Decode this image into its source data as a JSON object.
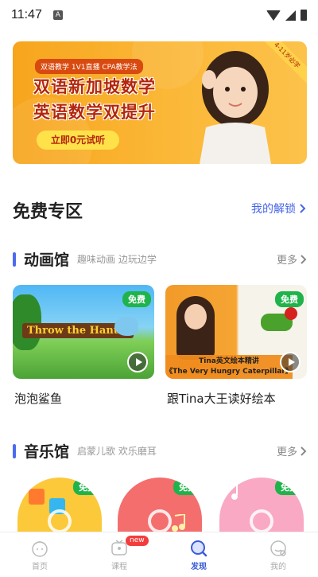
{
  "status_bar": {
    "time": "11:47",
    "notification_icon": "A"
  },
  "banner": {
    "tags": "双语教学  1V1直播  CPA教学法",
    "headline_1": "双语新加坡数学",
    "headline_2": "英语数学双提升",
    "cta": "立即0元试听",
    "corner_tag": "4-11岁必学",
    "carousel_count": 8,
    "carousel_active": 0
  },
  "free_zone": {
    "title": "免费专区",
    "unlock_link": "我的解锁"
  },
  "animation": {
    "title": "动画馆",
    "subtitle": "趣味动画 边玩边学",
    "more": "更多",
    "items": [
      {
        "label": "泡泡鲨鱼",
        "badge": "免费",
        "cover_text": "Throw the Hantle"
      },
      {
        "label": "跟Tina大王读好绘本",
        "badge": "免费",
        "cover_caption_1": "Tina英文绘本精讲",
        "cover_caption_2": "《The Very Hungry Caterpillar》"
      }
    ]
  },
  "music": {
    "title": "音乐馆",
    "subtitle": "启蒙儿歌 欢乐磨耳",
    "more": "更多",
    "items": [
      {
        "badge": "免费"
      },
      {
        "badge": "免费"
      },
      {
        "badge": "免费"
      }
    ]
  },
  "tabbar": {
    "tabs": [
      {
        "label": "首页",
        "icon": "home-icon"
      },
      {
        "label": "课程",
        "icon": "course-icon",
        "badge": "new"
      },
      {
        "label": "发现",
        "icon": "discover-icon",
        "active": true
      },
      {
        "label": "我的",
        "icon": "profile-icon"
      }
    ]
  },
  "colors": {
    "accent": "#4d6bf0",
    "free_badge": "#1fb34b",
    "banner": "#f7a51d"
  }
}
